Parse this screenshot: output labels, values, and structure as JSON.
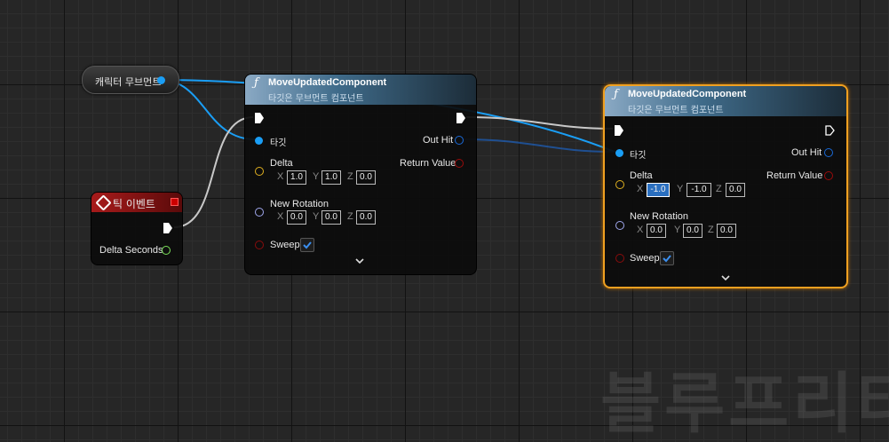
{
  "var_node": {
    "label": "캐릭터 무브먼트"
  },
  "event_node": {
    "title": "틱 이벤트",
    "pin_label": "Delta Seconds"
  },
  "func_left": {
    "title": "MoveUpdatedComponent",
    "subtitle": "타깃은 무브먼트 컴포넌트",
    "target_label": "타깃",
    "out_hit_label": "Out Hit",
    "return_label": "Return Value",
    "delta_label": "Delta",
    "delta": {
      "x": "1.0",
      "y": "1.0",
      "z": "0.0"
    },
    "rotation_label": "New Rotation",
    "rotation": {
      "x": "0.0",
      "y": "0.0",
      "z": "0.0"
    },
    "sweep_label": "Sweep",
    "sweep_checked": true
  },
  "func_right": {
    "title": "MoveUpdatedComponent",
    "subtitle": "타깃은 무브먼트 컴포넌트",
    "target_label": "타깃",
    "out_hit_label": "Out Hit",
    "return_label": "Return Value",
    "delta_label": "Delta",
    "delta": {
      "x": "-1.0",
      "y": "-1.0",
      "z": "0.0"
    },
    "rotation_label": "New Rotation",
    "rotation": {
      "x": "0.0",
      "y": "0.0",
      "z": "0.0"
    },
    "sweep_label": "Sweep",
    "sweep_checked": true
  },
  "axis_labels": {
    "x": "X",
    "y": "Y",
    "z": "Z"
  },
  "watermark": "블루프리터",
  "colors": {
    "object_pin": "#1a9ef5",
    "exec_wire": "#d0d0d0",
    "selection": "#f0a020",
    "event_header": "#a81b1b"
  },
  "icons": {
    "function": "function-icon",
    "event": "event-diamond-icon",
    "checkbox": "check-icon",
    "expand": "chevron-down-icon"
  }
}
